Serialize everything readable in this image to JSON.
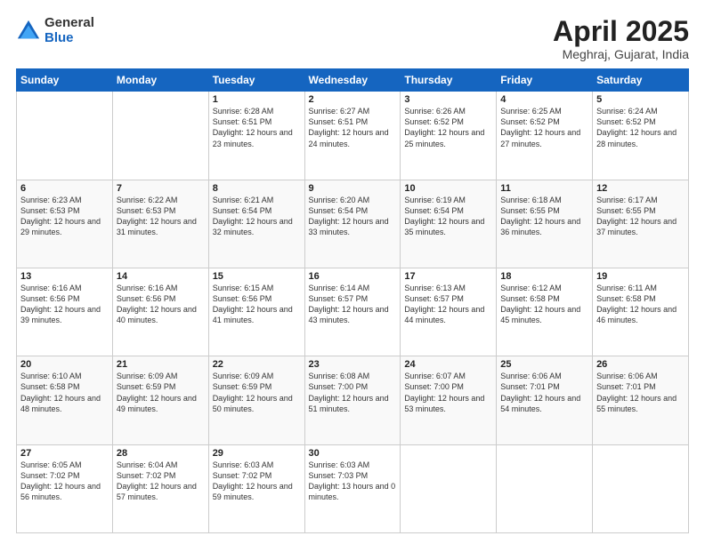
{
  "logo": {
    "general": "General",
    "blue": "Blue"
  },
  "title": "April 2025",
  "location": "Meghraj, Gujarat, India",
  "days_header": [
    "Sunday",
    "Monday",
    "Tuesday",
    "Wednesday",
    "Thursday",
    "Friday",
    "Saturday"
  ],
  "weeks": [
    [
      {
        "day": "",
        "sunrise": "",
        "sunset": "",
        "daylight": ""
      },
      {
        "day": "",
        "sunrise": "",
        "sunset": "",
        "daylight": ""
      },
      {
        "day": "1",
        "sunrise": "Sunrise: 6:28 AM",
        "sunset": "Sunset: 6:51 PM",
        "daylight": "Daylight: 12 hours and 23 minutes."
      },
      {
        "day": "2",
        "sunrise": "Sunrise: 6:27 AM",
        "sunset": "Sunset: 6:51 PM",
        "daylight": "Daylight: 12 hours and 24 minutes."
      },
      {
        "day": "3",
        "sunrise": "Sunrise: 6:26 AM",
        "sunset": "Sunset: 6:52 PM",
        "daylight": "Daylight: 12 hours and 25 minutes."
      },
      {
        "day": "4",
        "sunrise": "Sunrise: 6:25 AM",
        "sunset": "Sunset: 6:52 PM",
        "daylight": "Daylight: 12 hours and 27 minutes."
      },
      {
        "day": "5",
        "sunrise": "Sunrise: 6:24 AM",
        "sunset": "Sunset: 6:52 PM",
        "daylight": "Daylight: 12 hours and 28 minutes."
      }
    ],
    [
      {
        "day": "6",
        "sunrise": "Sunrise: 6:23 AM",
        "sunset": "Sunset: 6:53 PM",
        "daylight": "Daylight: 12 hours and 29 minutes."
      },
      {
        "day": "7",
        "sunrise": "Sunrise: 6:22 AM",
        "sunset": "Sunset: 6:53 PM",
        "daylight": "Daylight: 12 hours and 31 minutes."
      },
      {
        "day": "8",
        "sunrise": "Sunrise: 6:21 AM",
        "sunset": "Sunset: 6:54 PM",
        "daylight": "Daylight: 12 hours and 32 minutes."
      },
      {
        "day": "9",
        "sunrise": "Sunrise: 6:20 AM",
        "sunset": "Sunset: 6:54 PM",
        "daylight": "Daylight: 12 hours and 33 minutes."
      },
      {
        "day": "10",
        "sunrise": "Sunrise: 6:19 AM",
        "sunset": "Sunset: 6:54 PM",
        "daylight": "Daylight: 12 hours and 35 minutes."
      },
      {
        "day": "11",
        "sunrise": "Sunrise: 6:18 AM",
        "sunset": "Sunset: 6:55 PM",
        "daylight": "Daylight: 12 hours and 36 minutes."
      },
      {
        "day": "12",
        "sunrise": "Sunrise: 6:17 AM",
        "sunset": "Sunset: 6:55 PM",
        "daylight": "Daylight: 12 hours and 37 minutes."
      }
    ],
    [
      {
        "day": "13",
        "sunrise": "Sunrise: 6:16 AM",
        "sunset": "Sunset: 6:56 PM",
        "daylight": "Daylight: 12 hours and 39 minutes."
      },
      {
        "day": "14",
        "sunrise": "Sunrise: 6:16 AM",
        "sunset": "Sunset: 6:56 PM",
        "daylight": "Daylight: 12 hours and 40 minutes."
      },
      {
        "day": "15",
        "sunrise": "Sunrise: 6:15 AM",
        "sunset": "Sunset: 6:56 PM",
        "daylight": "Daylight: 12 hours and 41 minutes."
      },
      {
        "day": "16",
        "sunrise": "Sunrise: 6:14 AM",
        "sunset": "Sunset: 6:57 PM",
        "daylight": "Daylight: 12 hours and 43 minutes."
      },
      {
        "day": "17",
        "sunrise": "Sunrise: 6:13 AM",
        "sunset": "Sunset: 6:57 PM",
        "daylight": "Daylight: 12 hours and 44 minutes."
      },
      {
        "day": "18",
        "sunrise": "Sunrise: 6:12 AM",
        "sunset": "Sunset: 6:58 PM",
        "daylight": "Daylight: 12 hours and 45 minutes."
      },
      {
        "day": "19",
        "sunrise": "Sunrise: 6:11 AM",
        "sunset": "Sunset: 6:58 PM",
        "daylight": "Daylight: 12 hours and 46 minutes."
      }
    ],
    [
      {
        "day": "20",
        "sunrise": "Sunrise: 6:10 AM",
        "sunset": "Sunset: 6:58 PM",
        "daylight": "Daylight: 12 hours and 48 minutes."
      },
      {
        "day": "21",
        "sunrise": "Sunrise: 6:09 AM",
        "sunset": "Sunset: 6:59 PM",
        "daylight": "Daylight: 12 hours and 49 minutes."
      },
      {
        "day": "22",
        "sunrise": "Sunrise: 6:09 AM",
        "sunset": "Sunset: 6:59 PM",
        "daylight": "Daylight: 12 hours and 50 minutes."
      },
      {
        "day": "23",
        "sunrise": "Sunrise: 6:08 AM",
        "sunset": "Sunset: 7:00 PM",
        "daylight": "Daylight: 12 hours and 51 minutes."
      },
      {
        "day": "24",
        "sunrise": "Sunrise: 6:07 AM",
        "sunset": "Sunset: 7:00 PM",
        "daylight": "Daylight: 12 hours and 53 minutes."
      },
      {
        "day": "25",
        "sunrise": "Sunrise: 6:06 AM",
        "sunset": "Sunset: 7:01 PM",
        "daylight": "Daylight: 12 hours and 54 minutes."
      },
      {
        "day": "26",
        "sunrise": "Sunrise: 6:06 AM",
        "sunset": "Sunset: 7:01 PM",
        "daylight": "Daylight: 12 hours and 55 minutes."
      }
    ],
    [
      {
        "day": "27",
        "sunrise": "Sunrise: 6:05 AM",
        "sunset": "Sunset: 7:02 PM",
        "daylight": "Daylight: 12 hours and 56 minutes."
      },
      {
        "day": "28",
        "sunrise": "Sunrise: 6:04 AM",
        "sunset": "Sunset: 7:02 PM",
        "daylight": "Daylight: 12 hours and 57 minutes."
      },
      {
        "day": "29",
        "sunrise": "Sunrise: 6:03 AM",
        "sunset": "Sunset: 7:02 PM",
        "daylight": "Daylight: 12 hours and 59 minutes."
      },
      {
        "day": "30",
        "sunrise": "Sunrise: 6:03 AM",
        "sunset": "Sunset: 7:03 PM",
        "daylight": "Daylight: 13 hours and 0 minutes."
      },
      {
        "day": "",
        "sunrise": "",
        "sunset": "",
        "daylight": ""
      },
      {
        "day": "",
        "sunrise": "",
        "sunset": "",
        "daylight": ""
      },
      {
        "day": "",
        "sunrise": "",
        "sunset": "",
        "daylight": ""
      }
    ]
  ]
}
